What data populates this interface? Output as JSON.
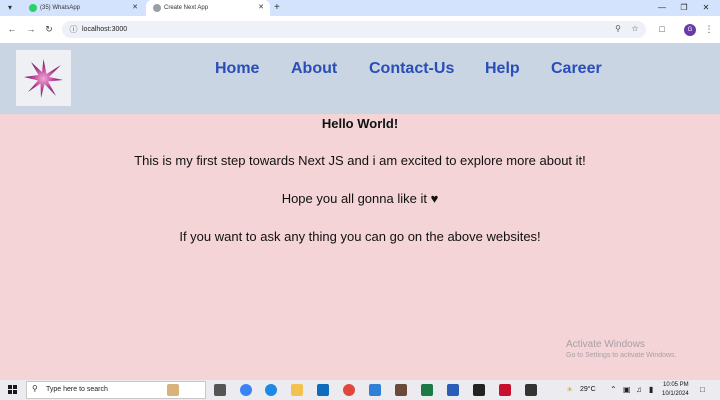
{
  "browser": {
    "tabs": [
      {
        "title": "(35) WhatsApp",
        "active": false
      },
      {
        "title": "Create Next App",
        "active": true
      }
    ],
    "new_tab_symbol": "+",
    "url": "localhost:3000",
    "profile_initial": "G"
  },
  "site": {
    "nav": [
      {
        "label": "Home"
      },
      {
        "label": "About"
      },
      {
        "label": "Contact-Us"
      },
      {
        "label": "Help"
      },
      {
        "label": "Career"
      }
    ],
    "colors": {
      "header_bg": "#c9d5e2",
      "body_bg": "#f4d4d6",
      "nav_link": "#2a4db8"
    }
  },
  "content": {
    "heading": "Hello World!",
    "line1": "This is my first step towards Next JS and i am excited to explore more about it!",
    "line2": "Hope you all gonna like it",
    "heart": "♥",
    "line3": "If you want to ask any thing you can go on the above websites!"
  },
  "watermark": {
    "title": "Activate Windows",
    "subtitle": "Go to Settings to activate Windows."
  },
  "taskbar": {
    "search_placeholder": "Type here to search",
    "weather": "29°C",
    "time": "10:05 PM",
    "date": "10/1/2024"
  }
}
